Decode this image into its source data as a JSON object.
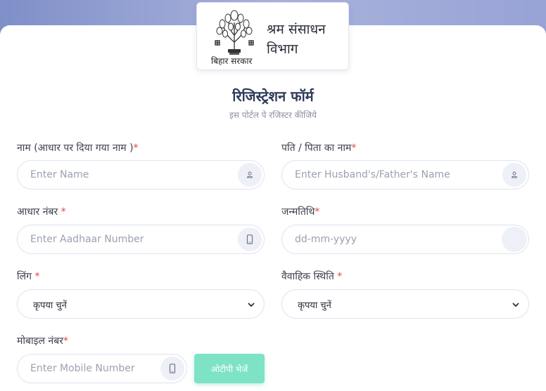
{
  "header": {
    "emblem_caption": "बिहार सरकार",
    "department_line1": "श्रम संसाधन",
    "department_line2": "विभाग"
  },
  "form": {
    "title": "रिजिस्ट्रेशन फॉर्म",
    "subtitle": "इस पोर्टल पे रजिस्टर कीजिये",
    "name": {
      "label": "नाम (आधार पर दिया गया नाम )",
      "required": "*",
      "placeholder": "Enter Name",
      "icon": "user-icon"
    },
    "father_name": {
      "label": "पति / पिता का नाम",
      "required": "*",
      "placeholder": "Enter Husband's/Father's Name",
      "icon": "user-icon"
    },
    "aadhaar": {
      "label": "आधार नंबर",
      "required": "*",
      "placeholder": "Enter Aadhaar Number",
      "icon": "mobile-icon"
    },
    "dob": {
      "label": "जन्मतिथि",
      "required": "*",
      "placeholder": "dd-mm-yyyy"
    },
    "gender": {
      "label": "लिंग",
      "required": "*",
      "selected": "कृपया चुनें",
      "icon": "chevron-down-icon"
    },
    "marital_status": {
      "label": "वैवाहिक स्थिति",
      "required": "*",
      "selected": "कृपया चुनें",
      "icon": "chevron-down-icon"
    },
    "mobile": {
      "label": "मोबाइल नंबर",
      "required": "*",
      "placeholder": "Enter Mobile Number",
      "icon": "mobile-icon"
    },
    "send_otp_label": "ओटीपी भेजें"
  },
  "colors": {
    "accent_button": "#7ee3c6",
    "required_mark": "#e04848",
    "title_text": "#2d3a5a"
  }
}
